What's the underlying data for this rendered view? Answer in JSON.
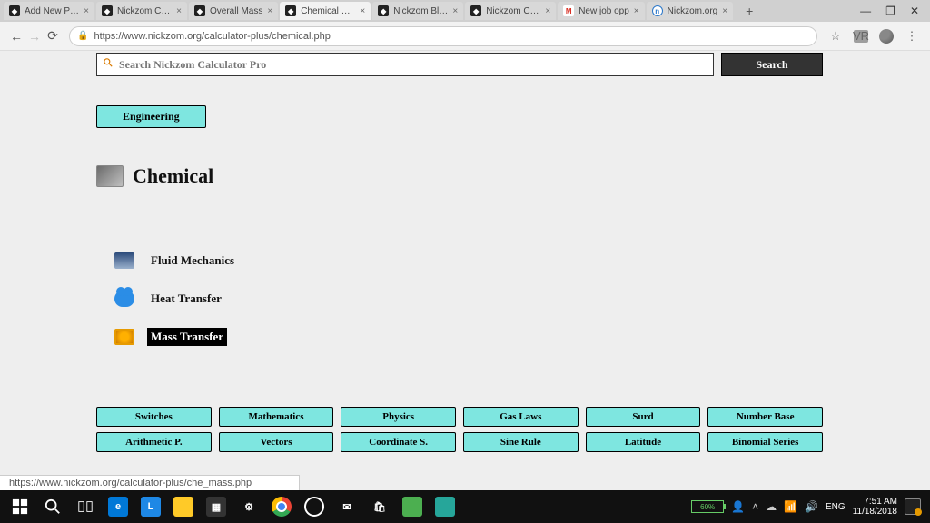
{
  "tabs": [
    {
      "label": "Add New Post",
      "favicon": "dark"
    },
    {
      "label": "Nickzom Calc",
      "favicon": "dark"
    },
    {
      "label": "Overall Mass",
      "favicon": "dark"
    },
    {
      "label": "Chemical Eng",
      "favicon": "dark",
      "active": true
    },
    {
      "label": "Nickzom Blog",
      "favicon": "dark"
    },
    {
      "label": "Nickzom Calc",
      "favicon": "dark"
    },
    {
      "label": "New job opp",
      "favicon": "gmail"
    },
    {
      "label": "Nickzom.org",
      "favicon": "nzorg"
    }
  ],
  "url": "https://www.nickzom.org/calculator-plus/chemical.php",
  "search": {
    "placeholder": "Search Nickzom Calculator Pro",
    "button": "Search"
  },
  "breadcrumb": {
    "engineering": "Engineering"
  },
  "page_title": "Chemical",
  "topics": {
    "fluid": "Fluid Mechanics",
    "heat": "Heat Transfer",
    "mass": "Mass Transfer"
  },
  "footer": [
    "Switches",
    "Mathematics",
    "Physics",
    "Gas Laws",
    "Surd",
    "Number Base",
    "Arithmetic P.",
    "Vectors",
    "Coordinate S.",
    "Sine Rule",
    "Latitude",
    "Binomial Series"
  ],
  "status_url": "https://www.nickzom.org/calculator-plus/che_mass.php",
  "tray": {
    "battery": "60%",
    "lang": "ENG",
    "time": "7:51 AM",
    "date": "11/18/2018"
  }
}
